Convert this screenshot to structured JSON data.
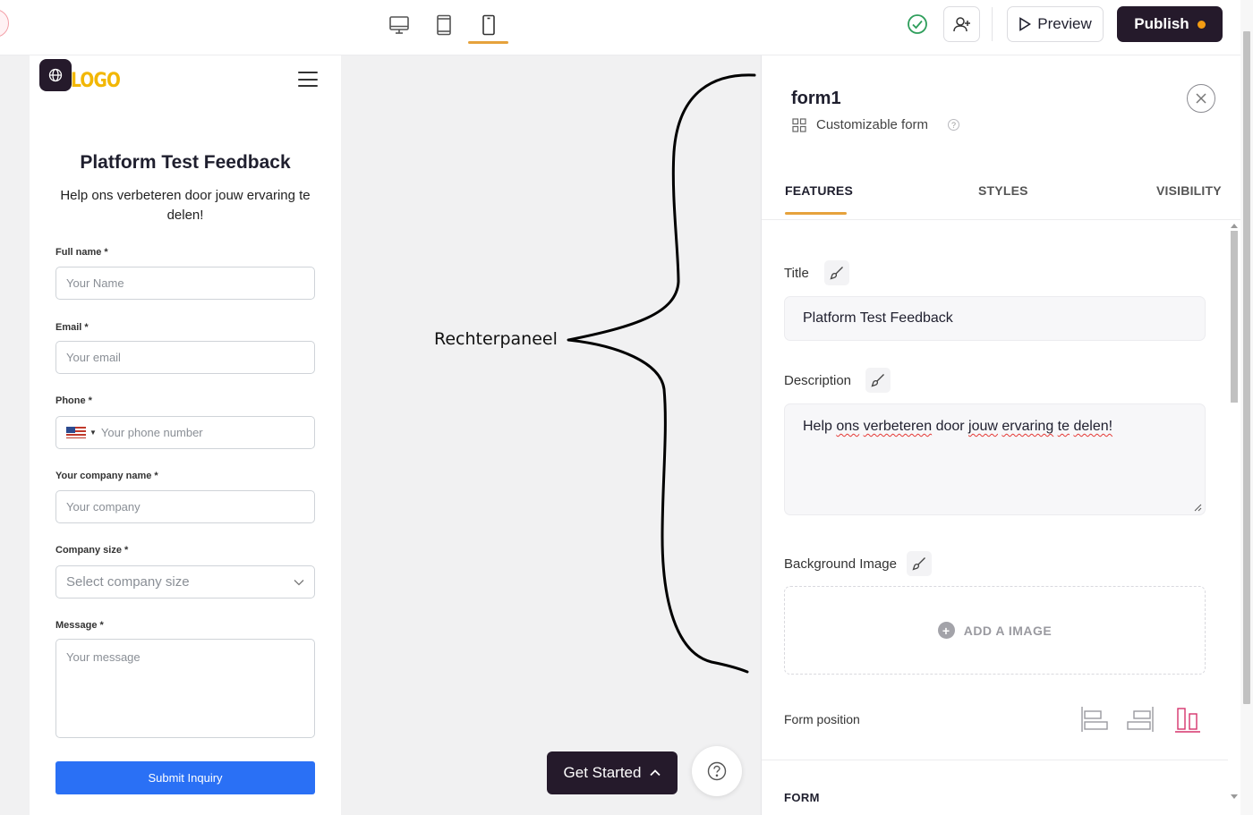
{
  "toolbar": {
    "devices": [
      "desktop",
      "tablet",
      "mobile"
    ],
    "active_device": "mobile",
    "preview_label": "Preview",
    "publish_label": "Publish"
  },
  "preview": {
    "logo_text": "LOGO",
    "title": "Platform Test Feedback",
    "description": "Help ons verbeteren door jouw ervaring te delen!",
    "fields": [
      {
        "label": "Full name *",
        "placeholder": "Your Name"
      },
      {
        "label": "Email *",
        "placeholder": "Your email"
      },
      {
        "label": "Phone *",
        "placeholder": "Your phone number"
      },
      {
        "label": "Your company name *",
        "placeholder": "Your company"
      },
      {
        "label": "Company size *",
        "placeholder": "Select company size"
      },
      {
        "label": "Message *",
        "placeholder": "Your message"
      }
    ],
    "submit_label": "Submit Inquiry"
  },
  "annotation": {
    "text": "Rechterpaneel"
  },
  "floating": {
    "get_started_label": "Get Started"
  },
  "panel": {
    "title": "form1",
    "subtitle": "Customizable form",
    "tabs": [
      "FEATURES",
      "STYLES",
      "VISIBILITY"
    ],
    "active_tab": "FEATURES",
    "title_label": "Title",
    "title_value": "Platform Test Feedback",
    "description_label": "Description",
    "description_words": [
      "Help",
      "ons",
      "verbeteren",
      "door",
      "jouw",
      "ervaring",
      "te",
      "delen!"
    ],
    "background_label": "Background Image",
    "add_image_label": "ADD A IMAGE",
    "form_position_label": "Form position",
    "form_position_selected": "center",
    "next_section_label": "FORM"
  },
  "colors": {
    "accent": "#e6a23c",
    "brand_dark": "#251a2b",
    "submit_blue": "#2a70f5",
    "logo_yellow": "#f2b705",
    "position_selected": "#d6336c",
    "saved_green": "#2e9e5b"
  }
}
